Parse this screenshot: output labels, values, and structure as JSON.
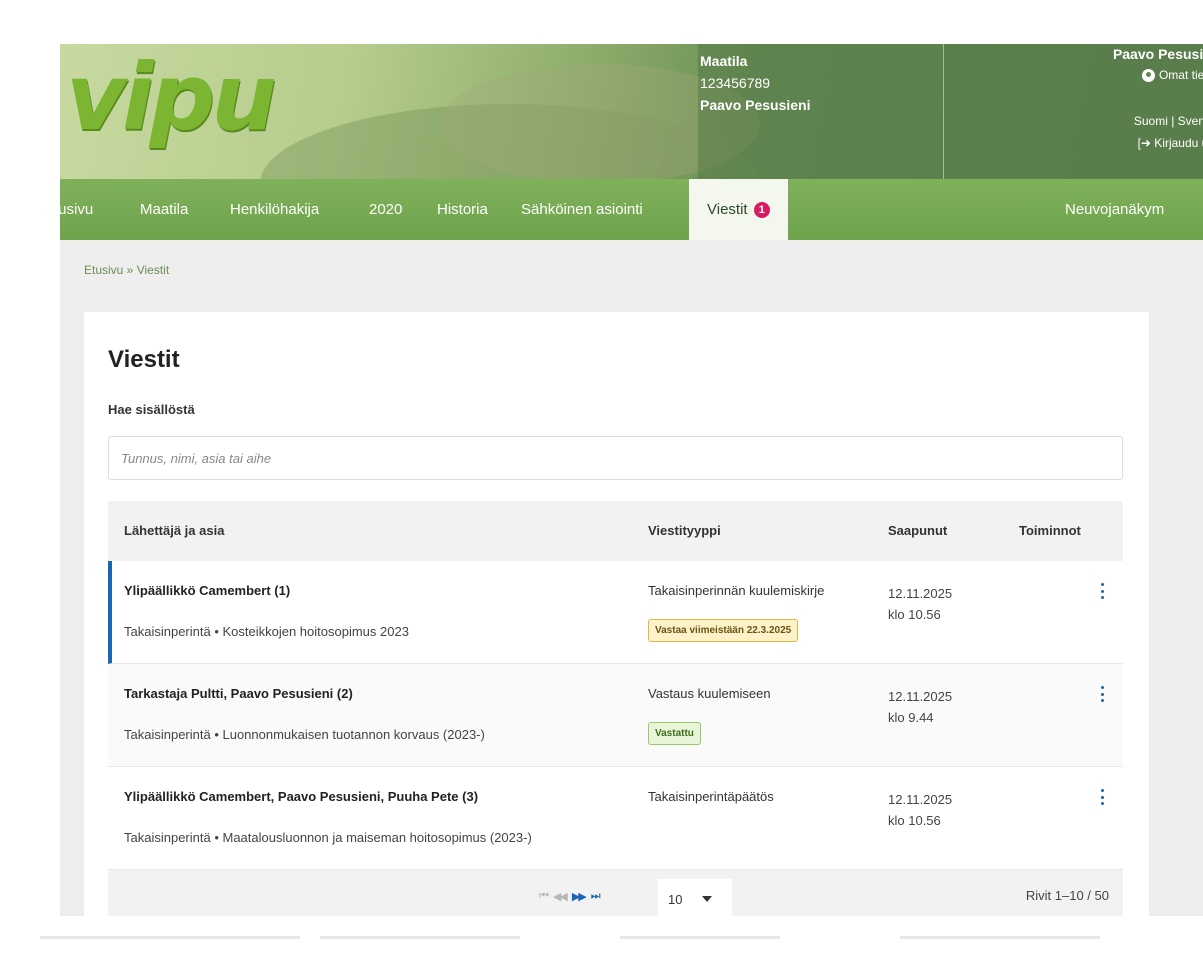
{
  "header": {
    "logo": "vipu",
    "farm": {
      "name": "Maatila",
      "id": "123456789",
      "owner": "Paavo Pesusieni"
    },
    "user": {
      "name": "Paavo Pesusie",
      "own_info": "Omat tied",
      "languages": "Suomi | Svens",
      "logout": "Kirjaudu ul"
    }
  },
  "nav": {
    "items": [
      "tusivu",
      "Maatila",
      "Henkilöhakija",
      "2020",
      "Historia",
      "Sähköinen asiointi"
    ],
    "active": "Viestit",
    "active_badge": "1",
    "right": "Neuvojanäkym"
  },
  "breadcrumb": "Etusivu » Viestit",
  "main": {
    "title": "Viestit",
    "search_label": "Hae sisällöstä",
    "search_placeholder": "Tunnus, nimi, asia tai aihe",
    "columns": [
      "Lähettäjä ja asia",
      "Viestityyppi",
      "Saapunut",
      "Toiminnot"
    ],
    "rows": [
      {
        "sender": "Ylipäällikkö Camembert  (1)",
        "subject": "Takaisinperintä • Kosteikkojen hoitosopimus 2023",
        "type": "Takaisinperinnän kuulemiskirje",
        "status": "Vastaa viimeistään 22.3.2025",
        "date": "12.11.2025",
        "time": "klo 10.56"
      },
      {
        "sender": "Tarkastaja Pultti, Paavo Pesusieni  (2)",
        "subject": "Takaisinperintä • Luonnonmukaisen tuotannon korvaus (2023-)",
        "type": "Vastaus kuulemiseen",
        "status": "Vastattu",
        "date": "12.11.2025",
        "time": "klo 9.44"
      },
      {
        "sender": "Ylipäällikkö Camembert, Paavo Pesusieni, Puuha Pete  (3)",
        "subject": "Takaisinperintä • Maatalousluonnon ja maiseman hoitosopimus (2023-)",
        "type": "Takaisinperintäpäätös",
        "status": "",
        "date": "12.11.2025",
        "time": "klo 10.56"
      }
    ],
    "pager": {
      "first": "⏮",
      "prev": "◀◀",
      "next": "▶▶",
      "last": "⏭",
      "page_size": "10",
      "rows_info": "Rivit 1–10 / 50"
    }
  },
  "icons": {
    "own_info": "person-circle-icon",
    "logout": "logout-arrow-icon",
    "actions": "kebab-menu-icon"
  },
  "colors": {
    "nav_green": "#72a84e",
    "badge_pink": "#d81b60",
    "accent_blue": "#1a66b5",
    "warn_bg": "#fdf2c8",
    "ok_bg": "#e9f5d8"
  }
}
